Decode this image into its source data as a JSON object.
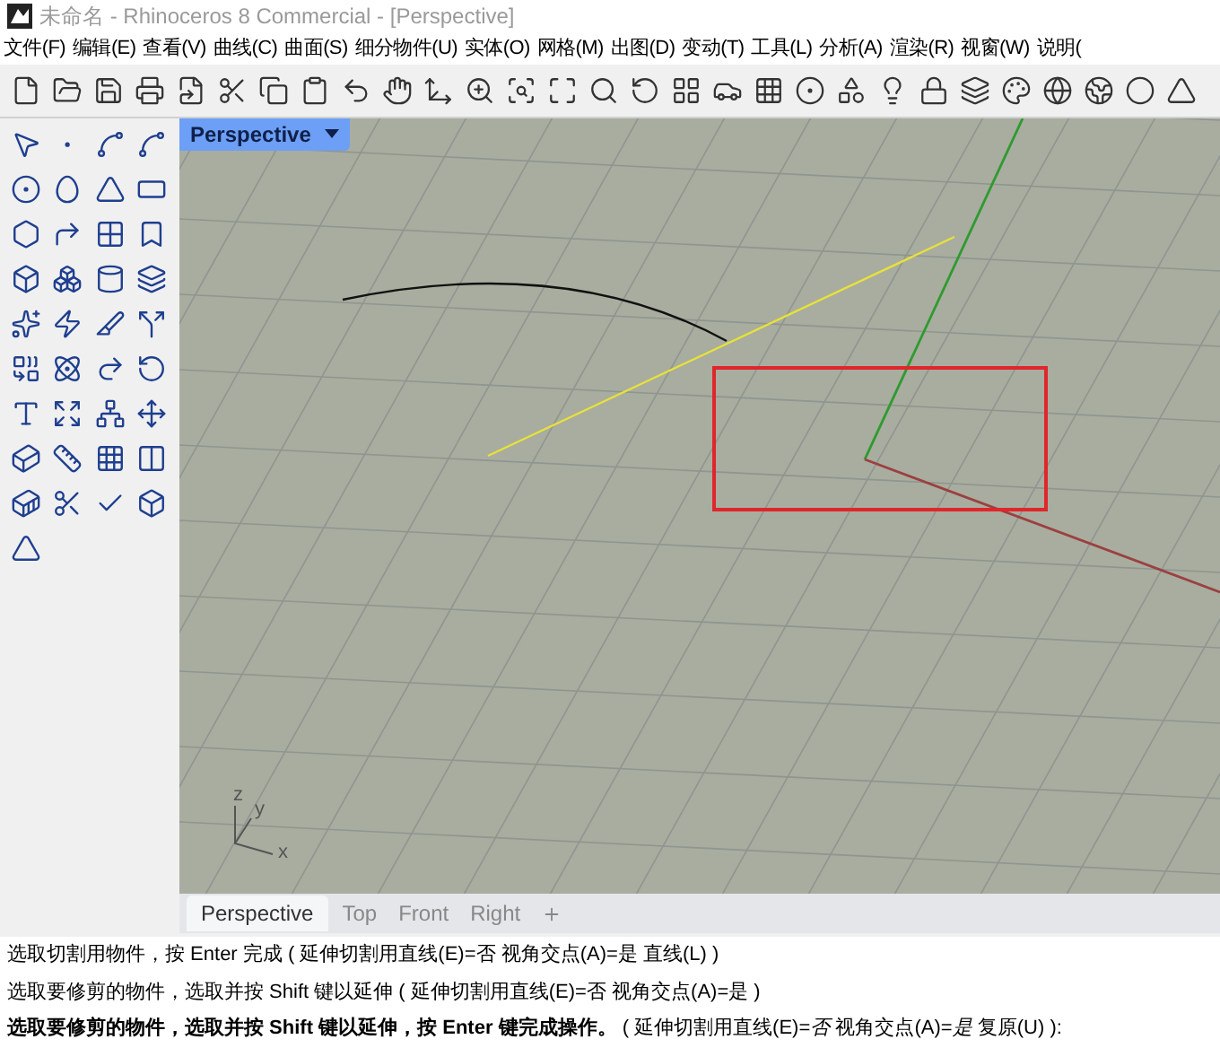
{
  "window": {
    "title": "未命名 - Rhinoceros 8 Commercial - [Perspective]"
  },
  "menu": [
    "文件(F)",
    "编辑(E)",
    "查看(V)",
    "曲线(C)",
    "曲面(S)",
    "细分物件(U)",
    "实体(O)",
    "网格(M)",
    "出图(D)",
    "变动(T)",
    "工具(L)",
    "分析(A)",
    "渲染(R)",
    "视窗(W)",
    "说明("
  ],
  "viewport": {
    "title": "Perspective",
    "axis_labels": {
      "z": "z",
      "y": "y",
      "x": "x"
    }
  },
  "viewport_tabs": [
    {
      "label": "Perspective",
      "selected": true
    },
    {
      "label": "Top",
      "selected": false
    },
    {
      "label": "Front",
      "selected": false
    },
    {
      "label": "Right",
      "selected": false
    }
  ],
  "command_history": [
    "选取切割用物件，按 Enter 完成 ( 延伸切割用直线(E)=否  视角交点(A)=是  直线(L) )",
    "选取要修剪的物件，选取并按 Shift 键以延伸 ( 延伸切割用直线(E)=否  视角交点(A)=是 )"
  ],
  "command_prompt": "**选取要修剪的物件，选取并按 Shift 键以延伸，按 Enter 键完成操作。** ( 延伸切割用直线(E)=*否*  视角交点(A)=*是*  复原(U) ):"
}
